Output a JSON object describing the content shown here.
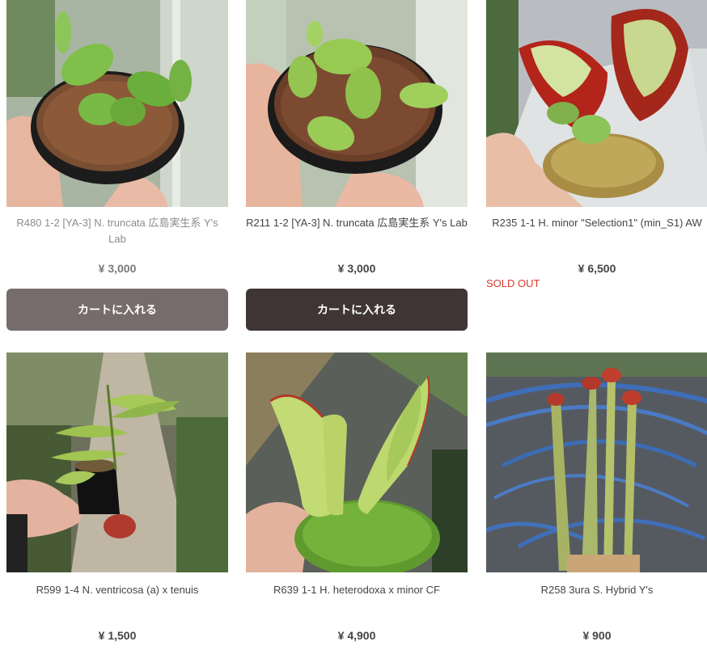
{
  "products": [
    {
      "name": "R480 1-2 [YA-3] N. truncata 広島実生系 Y's Lab",
      "price": "¥ 3,000",
      "button_label": "カートに入れる",
      "image_icon": "venus-flytrap-seedling-photo"
    },
    {
      "name": "R211 1-2 [YA-3] N. truncata 広島実生系 Y's Lab",
      "price": "¥ 3,000",
      "button_label": "カートに入れる",
      "image_icon": "venus-flytrap-seedling-photo"
    },
    {
      "name": "R235 1-1 H. minor \"Selection1\" (min_S1) AW",
      "price": "¥ 6,500",
      "status": "SOLD OUT",
      "image_icon": "heliamphora-red-pitcher-photo"
    },
    {
      "name": "R599 1-4 N. ventricosa (a) x tenuis",
      "price": "¥ 1,500",
      "image_icon": "nepenthes-hanging-plant-photo"
    },
    {
      "name": "R639 1-1 H. heterodoxa x minor CF",
      "price": "¥ 4,900",
      "image_icon": "heliamphora-green-pitcher-photo"
    },
    {
      "name": "R258 3ura S. Hybrid Y's",
      "price": "¥ 900",
      "image_icon": "sarracenia-tall-pitchers-photo"
    }
  ],
  "colors": {
    "button_light": "#766c6c",
    "button_dark": "#3f3535",
    "sold_out": "#d9382b"
  }
}
